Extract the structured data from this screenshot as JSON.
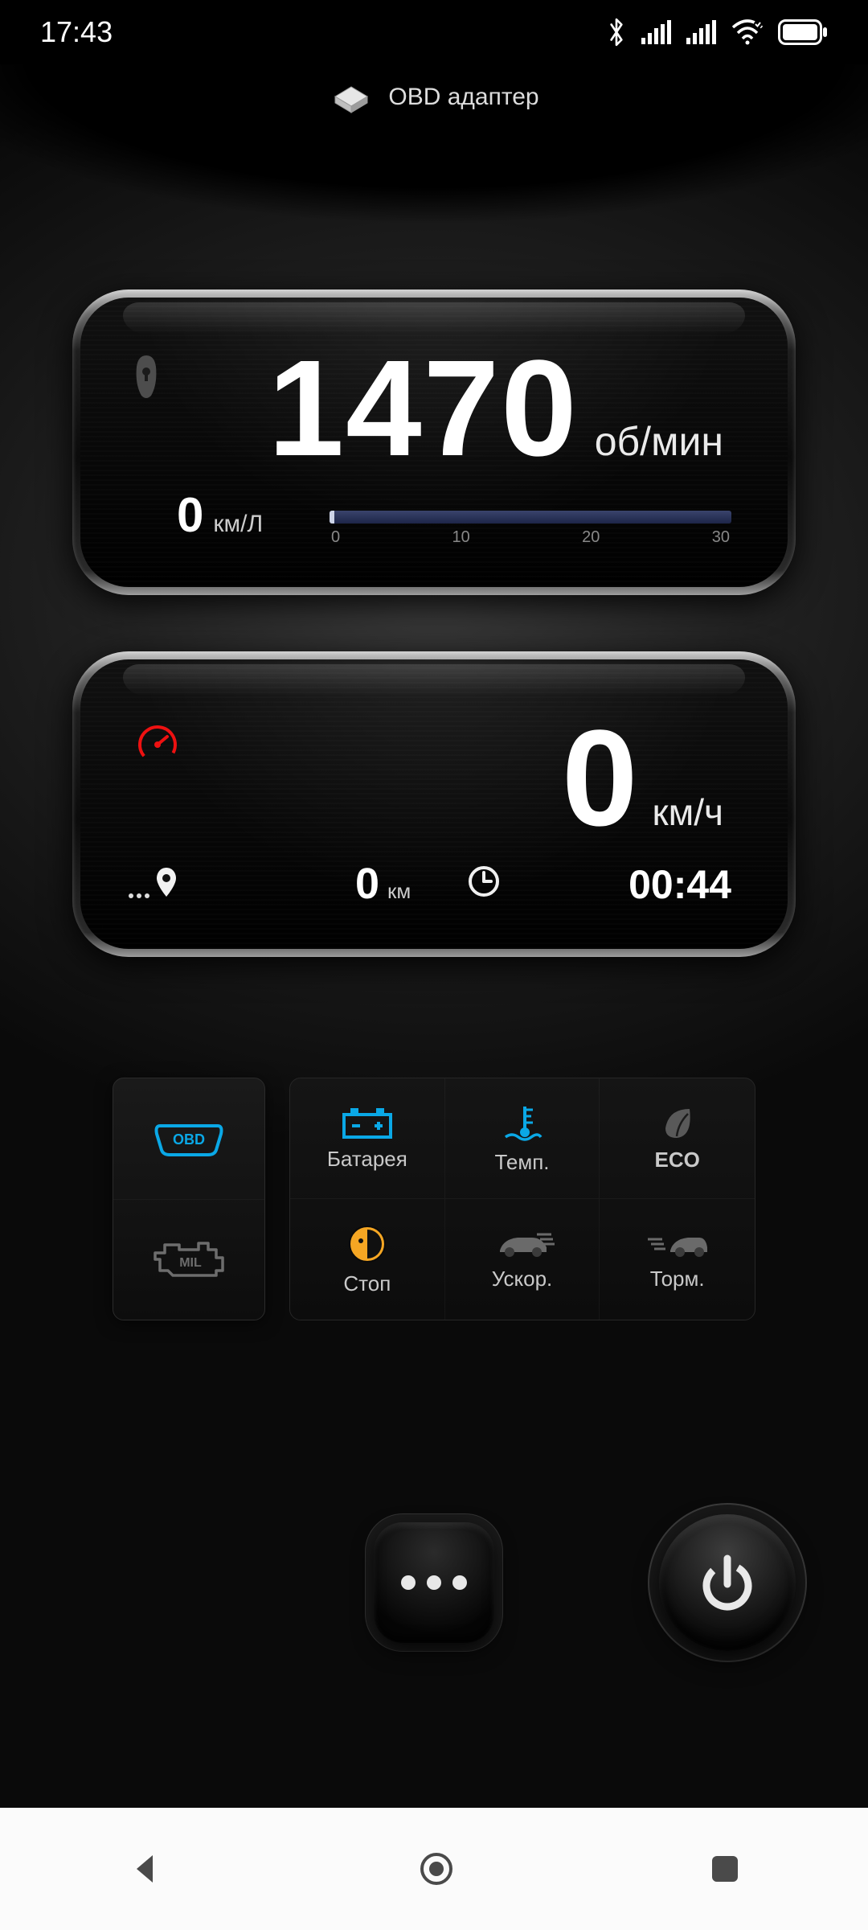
{
  "status": {
    "time": "17:43"
  },
  "header": {
    "title": "OBD адаптер"
  },
  "gauges": {
    "rpm": {
      "value": "1470",
      "unit": "об/мин",
      "fuel_value": "0",
      "fuel_unit": "км/Л",
      "ticks": [
        "0",
        "10",
        "20",
        "30"
      ]
    },
    "speed": {
      "value": "0",
      "unit": "км/ч",
      "distance_value": "0",
      "distance_unit": "км",
      "time": "00:44"
    }
  },
  "indicators": {
    "battery": "Батарея",
    "temp": "Темп.",
    "eco": "ECO",
    "stop": "Стоп",
    "accel": "Ускор.",
    "brake": "Торм."
  }
}
